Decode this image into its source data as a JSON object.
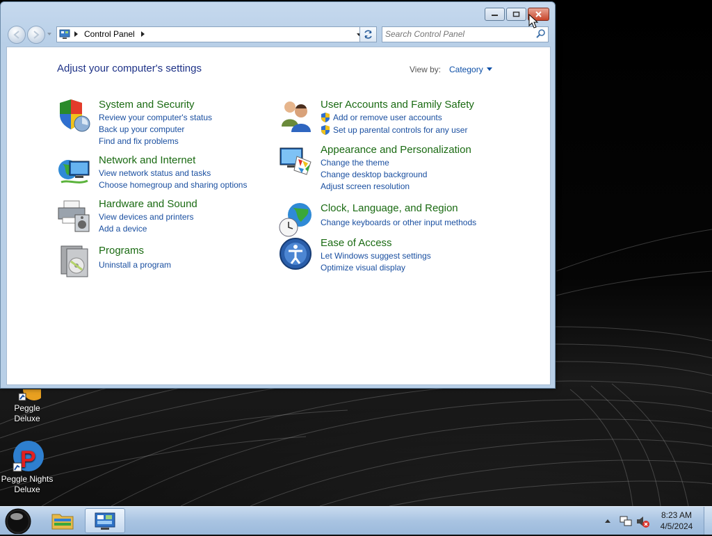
{
  "window": {
    "caption_buttons": {
      "minimize": "minimize-icon",
      "maximize": "maximize-icon",
      "close": "close-icon"
    }
  },
  "navbar": {
    "breadcrumb": "Control Panel",
    "search_placeholder": "Search Control Panel"
  },
  "main": {
    "heading": "Adjust your computer's settings",
    "view_by_label": "View by:",
    "view_by_value": "Category",
    "categories": [
      {
        "title": "System and Security",
        "icon": "shield-icon",
        "links": [
          "Review your computer's status",
          "Back up your computer",
          "Find and fix problems"
        ]
      },
      {
        "title": "Network and Internet",
        "icon": "globe-network-icon",
        "links": [
          "View network status and tasks",
          "Choose homegroup and sharing options"
        ]
      },
      {
        "title": "Hardware and Sound",
        "icon": "printer-speaker-icon",
        "links": [
          "View devices and printers",
          "Add a device"
        ]
      },
      {
        "title": "Programs",
        "icon": "programs-icon",
        "links": [
          "Uninstall a program"
        ]
      },
      {
        "title": "User Accounts and Family Safety",
        "icon": "users-icon",
        "links": [
          "Add or remove user accounts",
          "Set up parental controls for any user"
        ]
      },
      {
        "title": "Appearance and Personalization",
        "icon": "monitor-palette-icon",
        "links": [
          "Change the theme",
          "Change desktop background",
          "Adjust screen resolution"
        ]
      },
      {
        "title": "Clock, Language, and Region",
        "icon": "clock-globe-icon",
        "links": [
          "Change keyboards or other input methods"
        ]
      },
      {
        "title": "Ease of Access",
        "icon": "ease-of-access-icon",
        "links": [
          "Let Windows suggest settings",
          "Optimize visual display"
        ]
      }
    ]
  },
  "desktop": {
    "icons": [
      {
        "label": "Peggle Deluxe"
      },
      {
        "label": "Peggle Nights Deluxe"
      }
    ]
  },
  "taskbar": {
    "time": "8:23 AM",
    "date": "4/5/2024"
  },
  "colors": {
    "category_title": "#1a6a12",
    "link": "#1a4fa0",
    "heading": "#1e3287",
    "close_button": "#c8452b"
  }
}
